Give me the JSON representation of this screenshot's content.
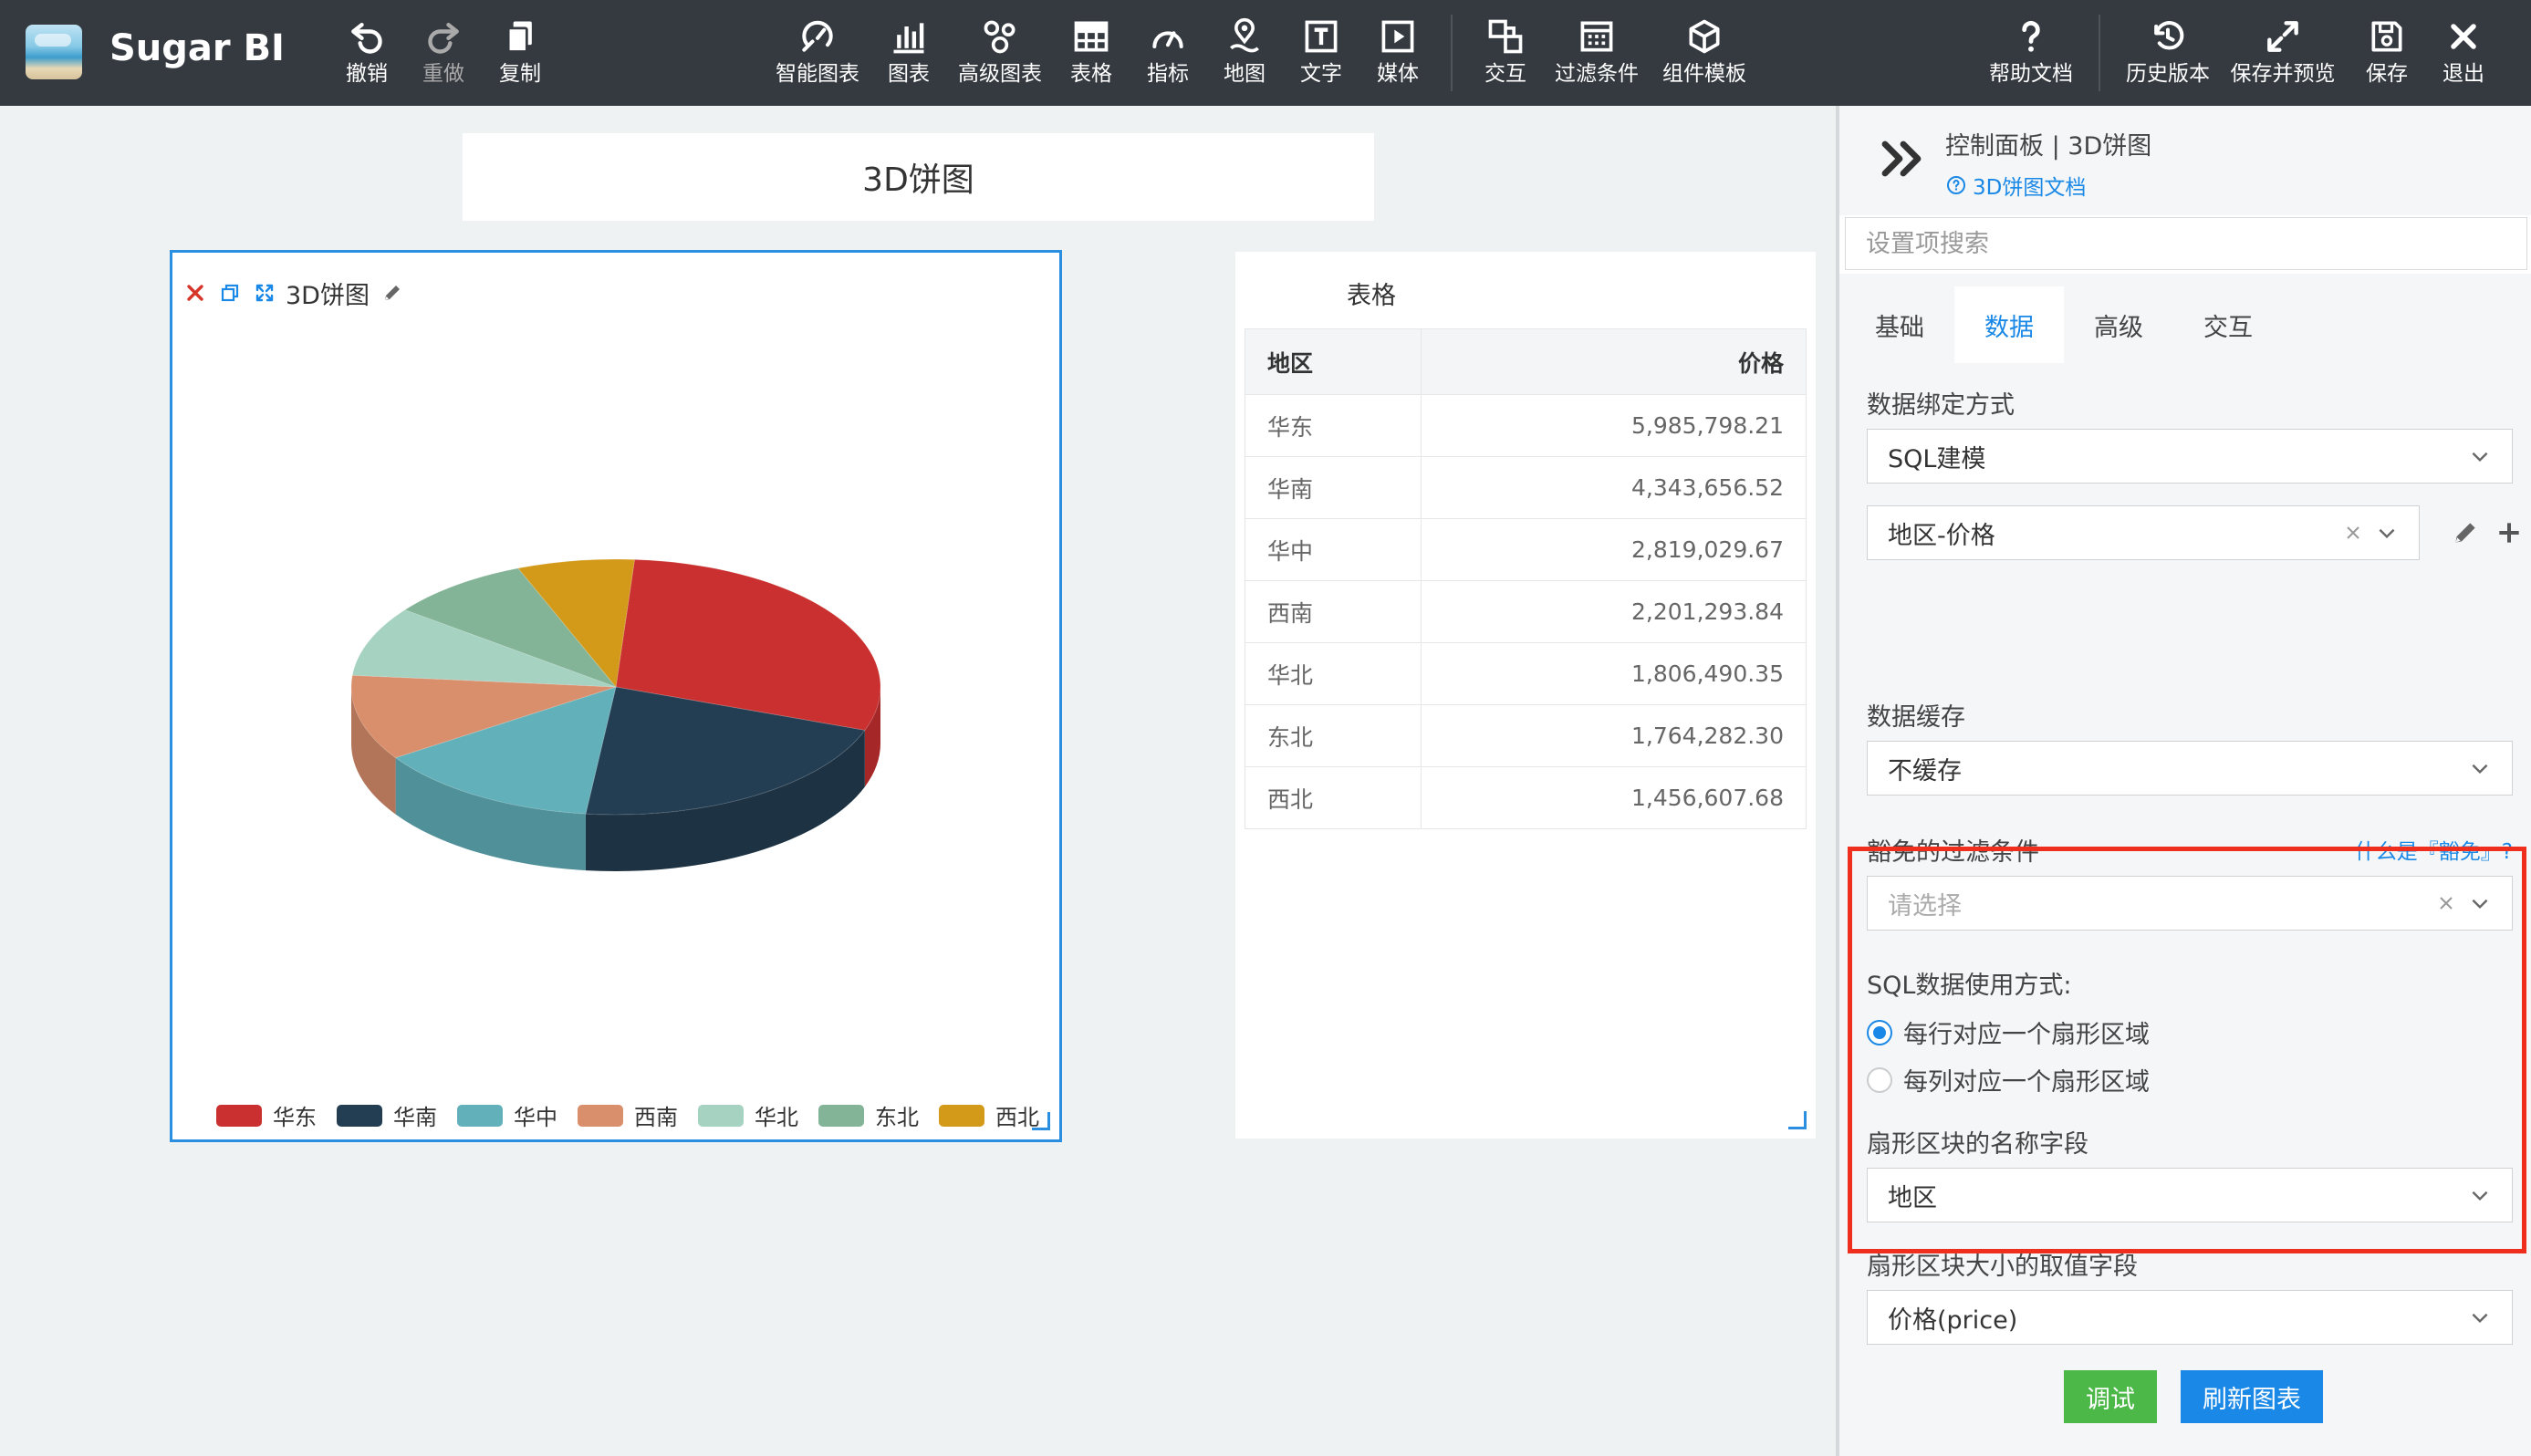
{
  "app": {
    "name": "Sugar BI"
  },
  "toolbar": {
    "left": [
      {
        "id": "undo",
        "label": "撤销"
      },
      {
        "id": "redo",
        "label": "重做"
      },
      {
        "id": "copy",
        "label": "复制"
      }
    ],
    "center": [
      {
        "id": "smart-chart",
        "label": "智能图表"
      },
      {
        "id": "chart",
        "label": "图表"
      },
      {
        "id": "advanced-chart",
        "label": "高级图表"
      },
      {
        "id": "table",
        "label": "表格"
      },
      {
        "id": "indicator",
        "label": "指标"
      },
      {
        "id": "map",
        "label": "地图"
      },
      {
        "id": "text",
        "label": "文字"
      },
      {
        "id": "media",
        "label": "媒体"
      },
      {
        "id": "interaction",
        "label": "交互"
      },
      {
        "id": "filter",
        "label": "过滤条件"
      },
      {
        "id": "component-template",
        "label": "组件模板"
      }
    ],
    "right": [
      {
        "id": "help",
        "label": "帮助文档"
      },
      {
        "id": "history",
        "label": "历史版本"
      },
      {
        "id": "save-preview",
        "label": "保存并预览"
      },
      {
        "id": "save",
        "label": "保存"
      },
      {
        "id": "exit",
        "label": "退出"
      }
    ]
  },
  "canvas": {
    "title": "3D饼图",
    "pie_card": {
      "title": "3D饼图"
    },
    "table_card": {
      "title": "表格",
      "columns": [
        "地区",
        "价格"
      ],
      "rows": [
        [
          "华东",
          "5,985,798.21"
        ],
        [
          "华南",
          "4,343,656.52"
        ],
        [
          "华中",
          "2,819,029.67"
        ],
        [
          "西南",
          "2,201,293.84"
        ],
        [
          "华北",
          "1,806,490.35"
        ],
        [
          "东北",
          "1,764,282.30"
        ],
        [
          "西北",
          "1,456,607.68"
        ]
      ]
    }
  },
  "chart_data": {
    "type": "pie",
    "variant": "3d",
    "categories": [
      "华东",
      "华南",
      "华中",
      "西南",
      "华北",
      "东北",
      "西北"
    ],
    "values": [
      5985798.21,
      4343656.52,
      2819029.67,
      2201293.84,
      1806490.35,
      1764282.3,
      1456607.68
    ],
    "colors": [
      "#c9302f",
      "#233d52",
      "#62b0b9",
      "#d98f6c",
      "#a6d2c2",
      "#84b497",
      "#d39a1a"
    ],
    "legend_position": "bottom"
  },
  "panel": {
    "title": "控制面板 | 3D饼图",
    "doc_link": "3D饼图文档",
    "search_placeholder": "设置项搜索",
    "tabs": [
      {
        "label": "基础",
        "active": false
      },
      {
        "label": "数据",
        "active": true
      },
      {
        "label": "高级",
        "active": false
      },
      {
        "label": "交互",
        "active": false
      }
    ],
    "binding_label": "数据绑定方式",
    "binding_value": "SQL建模",
    "model_value": "地区-价格",
    "cache_label": "数据缓存",
    "cache_value": "不缓存",
    "exempt_label": "豁免的过滤条件",
    "exempt_help": "什么是『豁免』?",
    "exempt_placeholder": "请选择",
    "sql_mode_label": "SQL数据使用方式:",
    "sql_mode_options": [
      {
        "label": "每行对应一个扇形区域",
        "checked": true
      },
      {
        "label": "每列对应一个扇形区域",
        "checked": false
      }
    ],
    "name_field_label": "扇形区块的名称字段",
    "name_field_value": "地区",
    "value_field_label": "扇形区块大小的取值字段",
    "value_field_value": "价格(price)",
    "debug_button": "调试",
    "refresh_button": "刷新图表"
  },
  "colors": {
    "accent": "#1a88e6",
    "highlight": "#ef2e1e",
    "success": "#4cb848",
    "toolbar_bg": "#353a40"
  }
}
